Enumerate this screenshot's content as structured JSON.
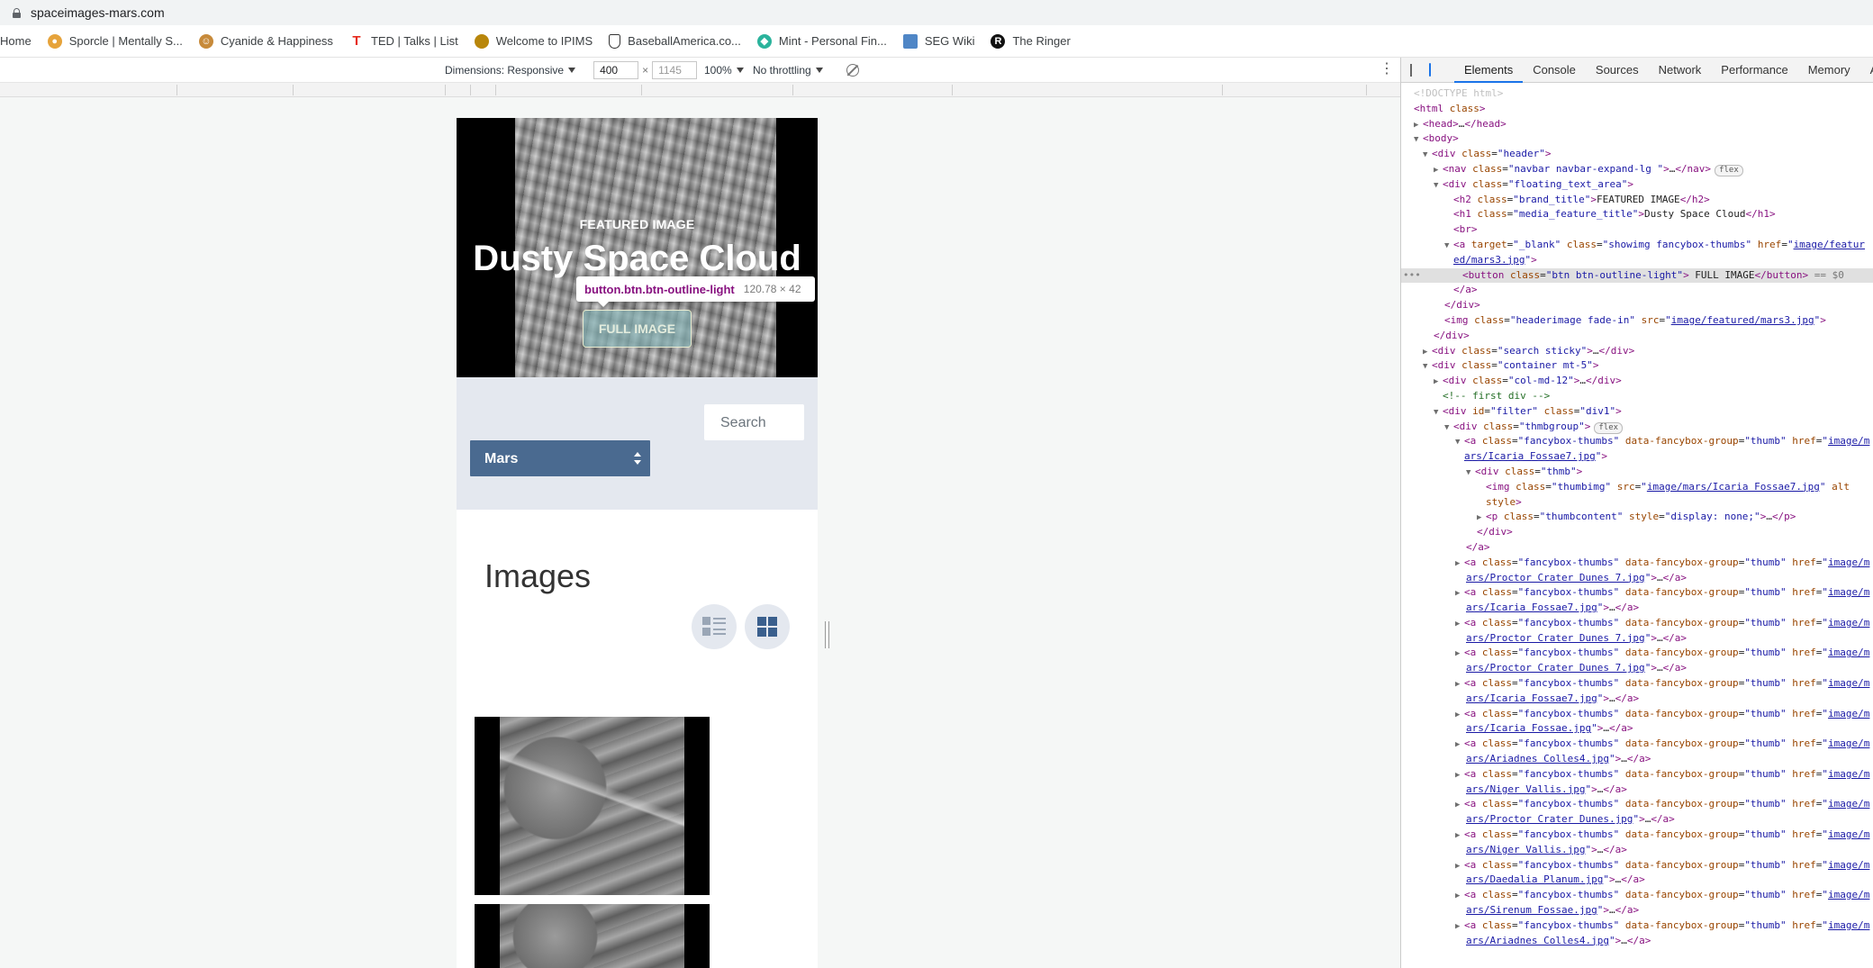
{
  "browser": {
    "url": "spaceimages-mars.com",
    "bookmarks": [
      {
        "label": "Home",
        "icon": "none"
      },
      {
        "label": "Sporcle | Mentally S...",
        "icon": "sporcle-icon",
        "color": "#e6a33b"
      },
      {
        "label": "Cyanide & Happiness",
        "icon": "cyanide-icon",
        "color": "#c78a3a"
      },
      {
        "label": "TED | Talks | List",
        "icon": "ted-icon",
        "color": "#e62b1e"
      },
      {
        "label": "Welcome to IPIMS",
        "icon": "ipims-icon",
        "color": "#b8860b"
      },
      {
        "label": "BaseballAmerica.co...",
        "icon": "shield-icon",
        "color": "#333333"
      },
      {
        "label": "Mint - Personal Fin...",
        "icon": "mint-icon",
        "color": "#2bb39c"
      },
      {
        "label": "SEG Wiki",
        "icon": "seg-icon",
        "color": "#4f86c6"
      },
      {
        "label": "The Ringer",
        "icon": "ringer-icon",
        "color": "#111111"
      }
    ]
  },
  "device_toolbar": {
    "dimensions_label": "Dimensions: Responsive",
    "width": "400",
    "height": "1145",
    "zoom": "100%",
    "throttling": "No throttling"
  },
  "page": {
    "brand_title": "FEATURED IMAGE",
    "media_title": "Dusty Space Cloud",
    "full_image_button": "FULL IMAGE",
    "search_placeholder": "Search",
    "select_value": "Mars",
    "images_heading": "Images"
  },
  "inspector_tooltip": {
    "selector": "button.btn.btn-outline-light",
    "size": "120.78 × 42"
  },
  "devtools": {
    "tabs": [
      "Elements",
      "Console",
      "Sources",
      "Network",
      "Performance",
      "Memory",
      "Ap"
    ],
    "active_tab": "Elements"
  }
}
